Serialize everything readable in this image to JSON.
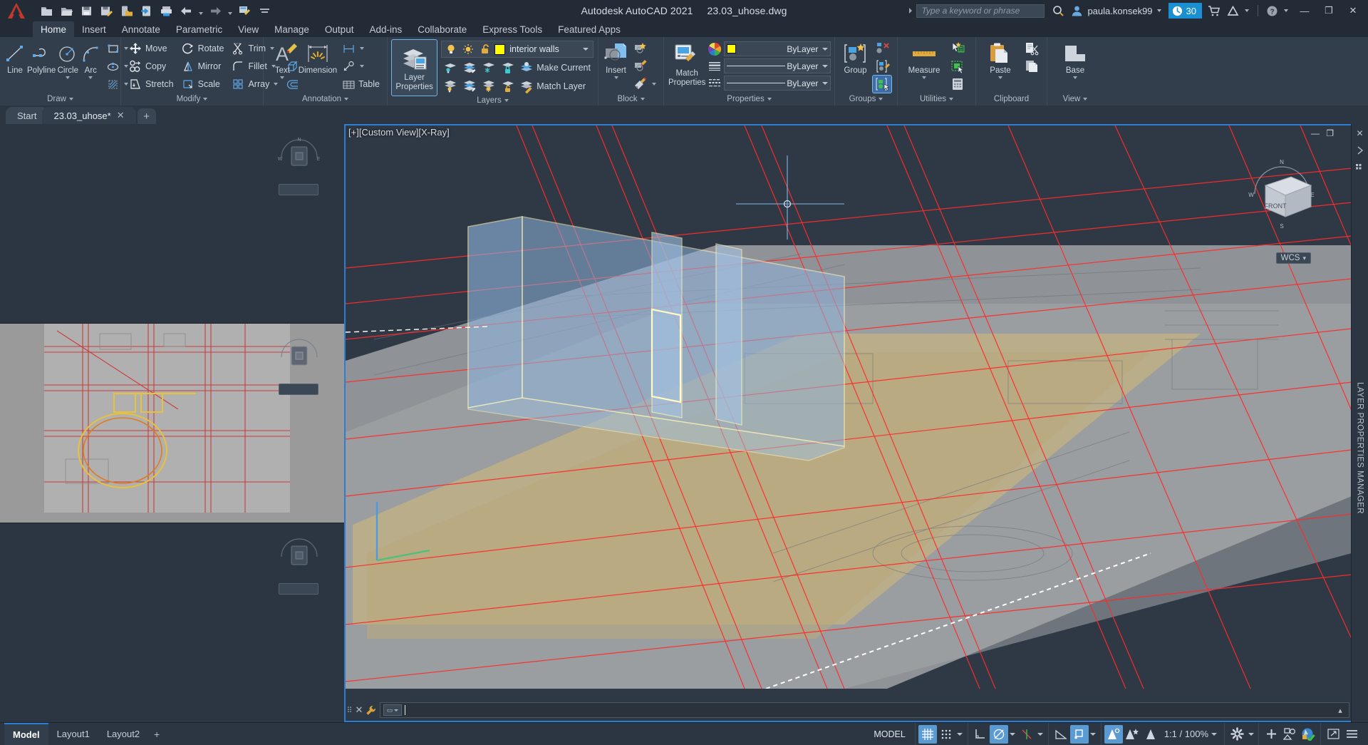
{
  "window": {
    "title_app": "Autodesk AutoCAD 2021",
    "title_file": "23.03_uhose.dwg",
    "minimize": "—",
    "restore": "❐",
    "close": "✕"
  },
  "quick_access": {
    "items": [
      {
        "name": "new-file-icon",
        "tooltip": "New"
      },
      {
        "name": "open-file-icon",
        "tooltip": "Open"
      },
      {
        "name": "save-icon",
        "tooltip": "Save"
      },
      {
        "name": "save-as-icon",
        "tooltip": "Save As"
      },
      {
        "name": "save-to-web-icon",
        "tooltip": "Save to Web & Mobile"
      },
      {
        "name": "open-from-web-icon",
        "tooltip": "Open from Web & Mobile"
      },
      {
        "name": "plot-icon",
        "tooltip": "Plot"
      },
      {
        "name": "undo-icon",
        "tooltip": "Undo"
      },
      {
        "name": "redo-icon",
        "tooltip": "Redo"
      },
      {
        "name": "batch-plot-icon",
        "tooltip": "Batch Plot"
      },
      {
        "name": "customize-qat-icon",
        "tooltip": "Customize Quick Access Toolbar"
      }
    ]
  },
  "search": {
    "placeholder": "Type a keyword or phrase"
  },
  "account": {
    "username": "paula.konsek99",
    "trial_days": "30",
    "trial_icon": "clock-icon",
    "shop_icon": "cart-icon",
    "autodesk_icon": "autodesk-a-icon",
    "help_icon": "help-icon",
    "search_icon": "search-icon",
    "user_icon": "user-avatar-icon"
  },
  "ribbon": {
    "tabs": [
      {
        "label": "Home",
        "active": true
      },
      {
        "label": "Insert",
        "active": false
      },
      {
        "label": "Annotate",
        "active": false
      },
      {
        "label": "Parametric",
        "active": false
      },
      {
        "label": "View",
        "active": false
      },
      {
        "label": "Manage",
        "active": false
      },
      {
        "label": "Output",
        "active": false
      },
      {
        "label": "Add-ins",
        "active": false
      },
      {
        "label": "Collaborate",
        "active": false
      },
      {
        "label": "Express Tools",
        "active": false
      },
      {
        "label": "Featured Apps",
        "active": false
      }
    ],
    "panels": {
      "draw": {
        "title": "Draw",
        "big": [
          {
            "label": "Line",
            "icon": "line-icon"
          },
          {
            "label": "Polyline",
            "icon": "polyline-icon"
          },
          {
            "label": "Circle",
            "icon": "circle-icon",
            "dropdown": true
          },
          {
            "label": "Arc",
            "icon": "arc-icon",
            "dropdown": true
          }
        ],
        "small": [
          {
            "icon": "rectangle-icon",
            "dropdown": true
          },
          {
            "icon": "ellipse-icon",
            "dropdown": true
          },
          {
            "icon": "hatch-icon",
            "dropdown": true
          }
        ]
      },
      "modify": {
        "title": "Modify",
        "col1": [
          {
            "label": "Move",
            "icon": "move-icon"
          },
          {
            "label": "Copy",
            "icon": "copy-icon"
          },
          {
            "label": "Stretch",
            "icon": "stretch-icon"
          }
        ],
        "col2": [
          {
            "label": "Rotate",
            "icon": "rotate-icon"
          },
          {
            "label": "Mirror",
            "icon": "mirror-icon"
          },
          {
            "label": "Scale",
            "icon": "scale-icon"
          }
        ],
        "col3": [
          {
            "label": "Trim",
            "icon": "trim-icon",
            "dropdown": true
          },
          {
            "label": "Fillet",
            "icon": "fillet-icon",
            "dropdown": true
          },
          {
            "label": "Array",
            "icon": "array-icon",
            "dropdown": true
          }
        ],
        "col4": [
          {
            "icon": "erase-icon"
          },
          {
            "icon": "explode-icon"
          },
          {
            "icon": "offset-icon"
          }
        ]
      },
      "annotation": {
        "title": "Annotation",
        "big": [
          {
            "label": "Text",
            "icon": "text-a-icon",
            "dropdown": true
          },
          {
            "label": "Dimension",
            "icon": "dimension-icon"
          }
        ],
        "small": [
          {
            "icon": "linear-dim-icon",
            "dropdown": true
          },
          {
            "icon": "leader-icon",
            "dropdown": true
          },
          {
            "label": "Table",
            "icon": "table-icon"
          }
        ]
      },
      "layers": {
        "title": "Layers",
        "big": {
          "label_1": "Layer",
          "label_2": "Properties",
          "icon": "layer-properties-icon",
          "selected": true
        },
        "current_layer": {
          "name": "interior walls",
          "color": "#FFFF00",
          "on_icon": "lightbulb-on-icon",
          "freeze_icon": "sun-icon",
          "lock_icon": "unlock-icon"
        },
        "row2_icons": [
          "layer-isolate-icon",
          "layer-unisolate-icon",
          "layer-freeze-icon",
          "layer-lock-icon"
        ],
        "row3_icons": [
          "layer-off-icon",
          "layer-turn-all-on-icon",
          "layer-thaw-all-icon",
          "layer-unlock-icon"
        ],
        "make_current": "Make Current",
        "match_layer": "Match Layer",
        "make_current_icon": "make-current-icon",
        "match_layer_icon": "match-layer-icon"
      },
      "block": {
        "title": "Block",
        "big": {
          "label": "Insert",
          "icon": "insert-block-icon",
          "dropdown": true
        },
        "small": [
          {
            "icon": "create-block-icon"
          },
          {
            "icon": "edit-block-icon"
          },
          {
            "icon": "edit-attribute-icon",
            "dropdown": true
          }
        ]
      },
      "properties": {
        "title": "Properties",
        "big": {
          "label_1": "Match",
          "label_2": "Properties",
          "icon": "match-properties-icon"
        },
        "color": {
          "value": "ByLayer",
          "swatch": "#FFFF00",
          "icon": "color-wheel-icon"
        },
        "linetype": {
          "value": "ByLayer",
          "icon": "linetype-icon"
        },
        "lineweight": {
          "value": "ByLayer",
          "icon": "lineweight-icon"
        }
      },
      "groups": {
        "title": "Groups",
        "big": {
          "label": "Group",
          "icon": "group-icon"
        },
        "small": [
          {
            "icon": "ungroup-icon"
          },
          {
            "icon": "group-edit-icon"
          },
          {
            "icon": "group-selection-on-icon",
            "selected": true
          }
        ]
      },
      "utilities": {
        "title": "Utilities",
        "big": {
          "label": "Measure",
          "icon": "measure-ruler-icon",
          "dropdown": true
        },
        "small": [
          {
            "icon": "quick-select-icon"
          },
          {
            "icon": "quick-calc-select-icon"
          },
          {
            "icon": "calculator-icon"
          }
        ]
      },
      "clipboard": {
        "title": "Clipboard",
        "big": {
          "label": "Paste",
          "icon": "paste-icon",
          "dropdown": true
        },
        "small": [
          {
            "icon": "cut-icon"
          },
          {
            "icon": "copy-clip-icon"
          }
        ]
      },
      "view": {
        "title": "View",
        "big": {
          "label": "Base",
          "icon": "base-view-icon",
          "dropdown": true
        }
      }
    }
  },
  "file_tabs": {
    "items": [
      {
        "label": "Start",
        "active": false,
        "closable": false
      },
      {
        "label": "23.03_uhose*",
        "active": true,
        "closable": true
      }
    ],
    "close_glyph": "✕",
    "new_tab_glyph": "+"
  },
  "viewport": {
    "label": "[+][Custom View][X-Ray]",
    "minimize_glyph": "—",
    "maximize_glyph": "❐",
    "wcs_label": "WCS",
    "viewcube_front": "FRONT",
    "viewcube_n": "N",
    "viewcube_s": "S",
    "viewcube_e": "E",
    "viewcube_w": "W",
    "wcs_dropdown": "▾"
  },
  "right_rail": {
    "close_glyph": "✕",
    "title": "LAYER PROPERTIES MANAGER",
    "icons": [
      "collapse-arrow-icon",
      "settings-icon"
    ]
  },
  "command_line": {
    "value": "",
    "prompt_glyph": "▾",
    "close_glyph": "✕",
    "wrench_icon": "wrench-icon",
    "grip_icon": "drag-grip-icon",
    "expand_glyph": "▴"
  },
  "status_bar": {
    "layout_tabs": [
      {
        "label": "Model",
        "active": true
      },
      {
        "label": "Layout1",
        "active": false
      },
      {
        "label": "Layout2",
        "active": false
      }
    ],
    "add_layout_glyph": "+",
    "model_button": "MODEL",
    "scale": "1:1 / 100%",
    "buttons": [
      {
        "name": "grid-display-button",
        "icon": "grid-icon",
        "on": true
      },
      {
        "name": "snap-mode-button",
        "icon": "snap-dots-icon",
        "on": false,
        "dropdown": true
      },
      {
        "name": "ortho-mode-button",
        "icon": "ortho-icon",
        "on": false
      },
      {
        "name": "polar-tracking-button",
        "icon": "polar-icon",
        "on": true,
        "dropdown": true
      },
      {
        "name": "object-snap-tracking-button",
        "icon": "osnap-track-icon",
        "on": false,
        "dropdown": true
      },
      {
        "name": "isometric-drafting-button",
        "icon": "iso-draft-icon",
        "on": false
      },
      {
        "name": "object-snap-button",
        "icon": "osnap-icon",
        "on": true,
        "dropdown": true
      },
      {
        "name": "ucs-icon-button",
        "icon": "ucs-a-icon",
        "on": false
      },
      {
        "name": "dynamic-ucs-button",
        "icon": "dyn-ucs-icon",
        "on": true
      },
      {
        "name": "selection-cycling-button",
        "icon": "sel-cycle-icon",
        "on": false
      },
      {
        "name": "annotation-visibility-button",
        "icon": "annot-vis-icon",
        "on": false
      },
      {
        "name": "annotation-scale-button",
        "icon": "annot-scale-icon",
        "on": false
      },
      {
        "name": "workspace-switching-button",
        "icon": "gear-icon",
        "on": false,
        "dropdown": true
      },
      {
        "name": "hardware-acceleration-button",
        "icon": "plus-icon",
        "on": false
      },
      {
        "name": "isolate-objects-button",
        "icon": "isolate-icon",
        "on": false
      },
      {
        "name": "graphics-performance-button",
        "icon": "graphics-perf-icon",
        "on": false
      },
      {
        "name": "clean-screen-button",
        "icon": "clean-screen-icon",
        "on": false
      },
      {
        "name": "customization-button",
        "icon": "hamburger-icon",
        "on": false
      }
    ]
  },
  "colors": {
    "accent": "#2a7fd4",
    "ribbon_bg": "#323e4c",
    "titlebar_bg": "#222b36",
    "layer_yellow": "#FFFF00",
    "trial_blue": "#1a8fd1",
    "selection_blue": "#5b8fc9",
    "wall_highlight": "#fff7c0",
    "xline_red": "#ff0000"
  }
}
